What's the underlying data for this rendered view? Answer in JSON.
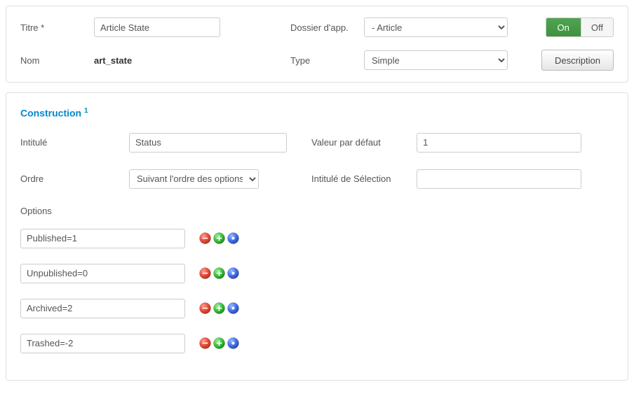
{
  "top": {
    "titre_label": "Titre *",
    "titre_value": "Article State",
    "dossier_label": "Dossier d'app.",
    "dossier_value": "- Article",
    "toggle_on": "On",
    "toggle_off": "Off",
    "nom_label": "Nom",
    "nom_value": "art_state",
    "type_label": "Type",
    "type_value": "Simple",
    "description_btn": "Description"
  },
  "section": {
    "title": "Construction",
    "sup": "1",
    "intitule_label": "Intitulé",
    "intitule_value": "Status",
    "defaut_label": "Valeur par défaut",
    "defaut_value": "1",
    "ordre_label": "Ordre",
    "ordre_value": "Suivant l'ordre des options",
    "selection_label": "Intitulé de Sélection",
    "selection_value": "",
    "options_label": "Options",
    "options": [
      "Published=1",
      "Unpublished=0",
      "Archived=2",
      "Trashed=-2"
    ]
  }
}
